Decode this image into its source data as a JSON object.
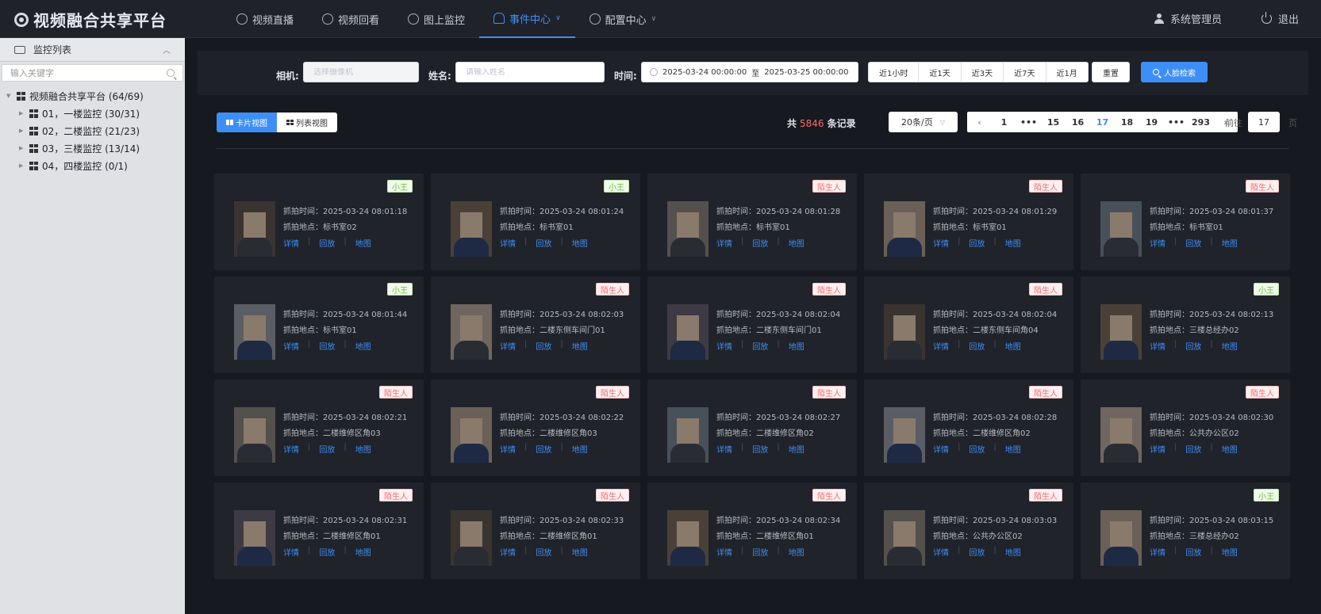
{
  "app": {
    "title": "视频融合共享平台"
  },
  "nav": [
    {
      "label": "视频直播",
      "icon": "play-circle-icon",
      "active": false,
      "dropdown": false
    },
    {
      "label": "视频回看",
      "icon": "replay-icon",
      "active": false,
      "dropdown": false
    },
    {
      "label": "图上监控",
      "icon": "map-pin-icon",
      "active": false,
      "dropdown": false
    },
    {
      "label": "事件中心",
      "icon": "bell-icon",
      "active": true,
      "dropdown": true
    },
    {
      "label": "配置中心",
      "icon": "gear-icon",
      "active": false,
      "dropdown": true
    }
  ],
  "header": {
    "user": "系统管理员",
    "logout": "退出"
  },
  "sidebar": {
    "title": "监控列表",
    "search_placeholder": "输入关键字",
    "root": "视频融合共享平台 (64/69)",
    "children": [
      "01，一楼监控 (30/31)",
      "02，二楼监控 (21/23)",
      "03，三楼监控 (13/14)",
      "04，四楼监控 (0/1)"
    ]
  },
  "filter": {
    "camera_label": "相机:",
    "camera_placeholder": "选择摄像机",
    "name_label": "姓名:",
    "name_placeholder": "请输入姓名",
    "time_label": "时间:",
    "start": "2025-03-24 00:00:00",
    "range_sep": "至",
    "end": "2025-03-25 00:00:00",
    "quick": [
      "近1小时",
      "近1天",
      "近3天",
      "近7天",
      "近1月"
    ],
    "reset": "重置",
    "face_search": "人脸检索"
  },
  "toolbar": {
    "card_view": "卡片视图",
    "list_view": "列表视图",
    "total_prefix": "共",
    "total_count": "5846",
    "total_suffix": "条记录",
    "page_size": "20条/页",
    "pages": [
      "1",
      "•••",
      "15",
      "16",
      "17",
      "18",
      "19",
      "•••",
      "293"
    ],
    "current_page": "17",
    "jump_prefix": "前往",
    "jump_value": "17",
    "jump_suffix": "页"
  },
  "card_labels": {
    "time_prefix": "抓拍时间：",
    "place_prefix": "抓拍地点：",
    "detail": "详情",
    "playback": "回放",
    "map": "地图"
  },
  "records": [
    {
      "tag": "小王",
      "tag_color": "green",
      "time": "2025-03-24 08:01:18",
      "place": "标书室02"
    },
    {
      "tag": "小王",
      "tag_color": "green",
      "time": "2025-03-24 08:01:24",
      "place": "标书室01"
    },
    {
      "tag": "陌生人",
      "tag_color": "red",
      "time": "2025-03-24 08:01:28",
      "place": "标书室01"
    },
    {
      "tag": "陌生人",
      "tag_color": "red",
      "time": "2025-03-24 08:01:29",
      "place": "标书室01"
    },
    {
      "tag": "陌生人",
      "tag_color": "red",
      "time": "2025-03-24 08:01:37",
      "place": "标书室01"
    },
    {
      "tag": "小王",
      "tag_color": "green",
      "time": "2025-03-24 08:01:44",
      "place": "标书室01"
    },
    {
      "tag": "陌生人",
      "tag_color": "red",
      "time": "2025-03-24 08:02:03",
      "place": "二楼东侧车间门01"
    },
    {
      "tag": "陌生人",
      "tag_color": "red",
      "time": "2025-03-24 08:02:04",
      "place": "二楼东侧车间门01"
    },
    {
      "tag": "陌生人",
      "tag_color": "red",
      "time": "2025-03-24 08:02:04",
      "place": "二楼东侧车间角04"
    },
    {
      "tag": "小王",
      "tag_color": "green",
      "time": "2025-03-24 08:02:13",
      "place": "三楼总经办02"
    },
    {
      "tag": "陌生人",
      "tag_color": "red",
      "time": "2025-03-24 08:02:21",
      "place": "二楼维修区角03"
    },
    {
      "tag": "陌生人",
      "tag_color": "red",
      "time": "2025-03-24 08:02:22",
      "place": "二楼维修区角03"
    },
    {
      "tag": "陌生人",
      "tag_color": "red",
      "time": "2025-03-24 08:02:27",
      "place": "二楼维修区角02"
    },
    {
      "tag": "陌生人",
      "tag_color": "red",
      "time": "2025-03-24 08:02:28",
      "place": "二楼维修区角02"
    },
    {
      "tag": "陌生人",
      "tag_color": "red",
      "time": "2025-03-24 08:02:30",
      "place": "公共办公区02"
    },
    {
      "tag": "陌生人",
      "tag_color": "red",
      "time": "2025-03-24 08:02:31",
      "place": "二楼维修区角01"
    },
    {
      "tag": "陌生人",
      "tag_color": "red",
      "time": "2025-03-24 08:02:33",
      "place": "二楼维修区角01"
    },
    {
      "tag": "陌生人",
      "tag_color": "red",
      "time": "2025-03-24 08:02:34",
      "place": "二楼维修区角01"
    },
    {
      "tag": "陌生人",
      "tag_color": "red",
      "time": "2025-03-24 08:03:03",
      "place": "公共办公区02"
    },
    {
      "tag": "小王",
      "tag_color": "green",
      "time": "2025-03-24 08:03:15",
      "place": "三楼总经办02"
    }
  ],
  "colors": {
    "accent": "#3e8ef7",
    "danger": "#f56c6c",
    "success": "#67c23a"
  }
}
